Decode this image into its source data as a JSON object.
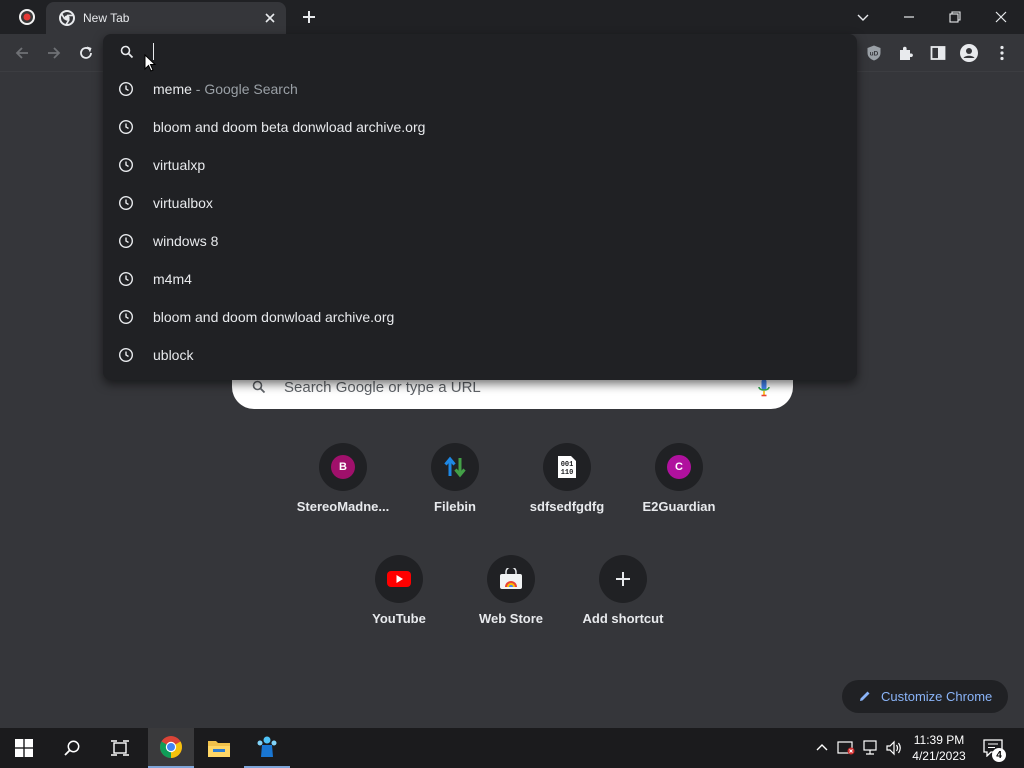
{
  "window": {
    "tab_title": "New Tab"
  },
  "omnibox": {
    "input_value": "",
    "suggestions": [
      {
        "text": "meme",
        "sub": " - Google Search"
      },
      {
        "text": "bloom and doom beta donwload archive.org",
        "sub": ""
      },
      {
        "text": "virtualxp",
        "sub": ""
      },
      {
        "text": "virtualbox",
        "sub": ""
      },
      {
        "text": "windows 8",
        "sub": ""
      },
      {
        "text": "m4m4",
        "sub": ""
      },
      {
        "text": "bloom and doom donwload archive.org",
        "sub": ""
      },
      {
        "text": "ublock",
        "sub": ""
      }
    ]
  },
  "ntp": {
    "search_placeholder": "Search Google or type a URL",
    "shortcuts": [
      {
        "label": "StereoMadne...",
        "icon": "letter-b",
        "letter": "B",
        "color": "#a0106b"
      },
      {
        "label": "Filebin",
        "icon": "up-down-arrows-icon"
      },
      {
        "label": "sdfsedfgdfg",
        "icon": "binary-file-icon"
      },
      {
        "label": "E2Guardian",
        "icon": "letter-c",
        "letter": "C",
        "color": "#b0119e"
      },
      {
        "label": "YouTube",
        "icon": "youtube-icon"
      },
      {
        "label": "Web Store",
        "icon": "web-store-icon"
      },
      {
        "label": "Add shortcut",
        "icon": "plus-icon"
      }
    ],
    "customize_label": "Customize Chrome"
  },
  "taskbar": {
    "time": "11:39 PM",
    "date": "4/21/2023",
    "notification_count": "4"
  },
  "colors": {
    "accent": "#8ab4f8",
    "background": "#35363a",
    "omnibox_bg": "#202124"
  }
}
